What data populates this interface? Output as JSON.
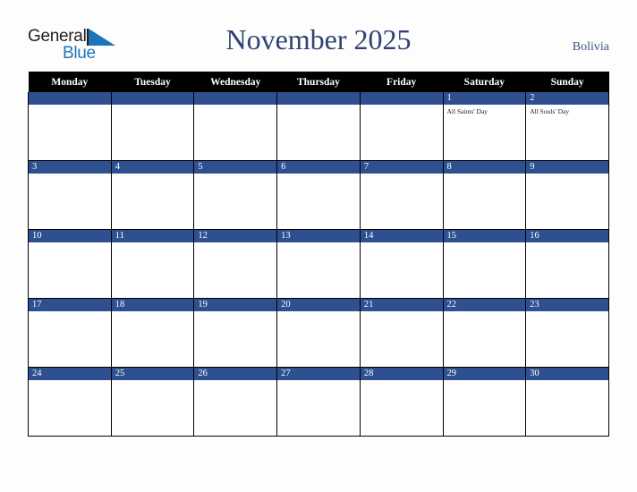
{
  "brand": {
    "word1": "General",
    "word2": "Blue",
    "color1": "#231f20",
    "color2": "#1b75bb",
    "triangle_color": "#1b75bb"
  },
  "header": {
    "title": "November 2025",
    "country": "Bolivia",
    "title_color": "#2e4372"
  },
  "colors": {
    "header_row_bg": "#000000",
    "day_bar_bg": "#2e5090",
    "grid_line": "#000000",
    "page_bg": "#fdfdfd",
    "cell_bg": "#ffffff"
  },
  "calendar": {
    "weekday_headers": [
      "Monday",
      "Tuesday",
      "Wednesday",
      "Thursday",
      "Friday",
      "Saturday",
      "Sunday"
    ],
    "weeks": [
      [
        {
          "day": "",
          "events": []
        },
        {
          "day": "",
          "events": []
        },
        {
          "day": "",
          "events": []
        },
        {
          "day": "",
          "events": []
        },
        {
          "day": "",
          "events": []
        },
        {
          "day": "1",
          "events": [
            "All Saints' Day"
          ]
        },
        {
          "day": "2",
          "events": [
            "All Souls' Day"
          ]
        }
      ],
      [
        {
          "day": "3",
          "events": []
        },
        {
          "day": "4",
          "events": []
        },
        {
          "day": "5",
          "events": []
        },
        {
          "day": "6",
          "events": []
        },
        {
          "day": "7",
          "events": []
        },
        {
          "day": "8",
          "events": []
        },
        {
          "day": "9",
          "events": []
        }
      ],
      [
        {
          "day": "10",
          "events": []
        },
        {
          "day": "11",
          "events": []
        },
        {
          "day": "12",
          "events": []
        },
        {
          "day": "13",
          "events": []
        },
        {
          "day": "14",
          "events": []
        },
        {
          "day": "15",
          "events": []
        },
        {
          "day": "16",
          "events": []
        }
      ],
      [
        {
          "day": "17",
          "events": []
        },
        {
          "day": "18",
          "events": []
        },
        {
          "day": "19",
          "events": []
        },
        {
          "day": "20",
          "events": []
        },
        {
          "day": "21",
          "events": []
        },
        {
          "day": "22",
          "events": []
        },
        {
          "day": "23",
          "events": []
        }
      ],
      [
        {
          "day": "24",
          "events": []
        },
        {
          "day": "25",
          "events": []
        },
        {
          "day": "26",
          "events": []
        },
        {
          "day": "27",
          "events": []
        },
        {
          "day": "28",
          "events": []
        },
        {
          "day": "29",
          "events": []
        },
        {
          "day": "30",
          "events": []
        }
      ]
    ]
  }
}
